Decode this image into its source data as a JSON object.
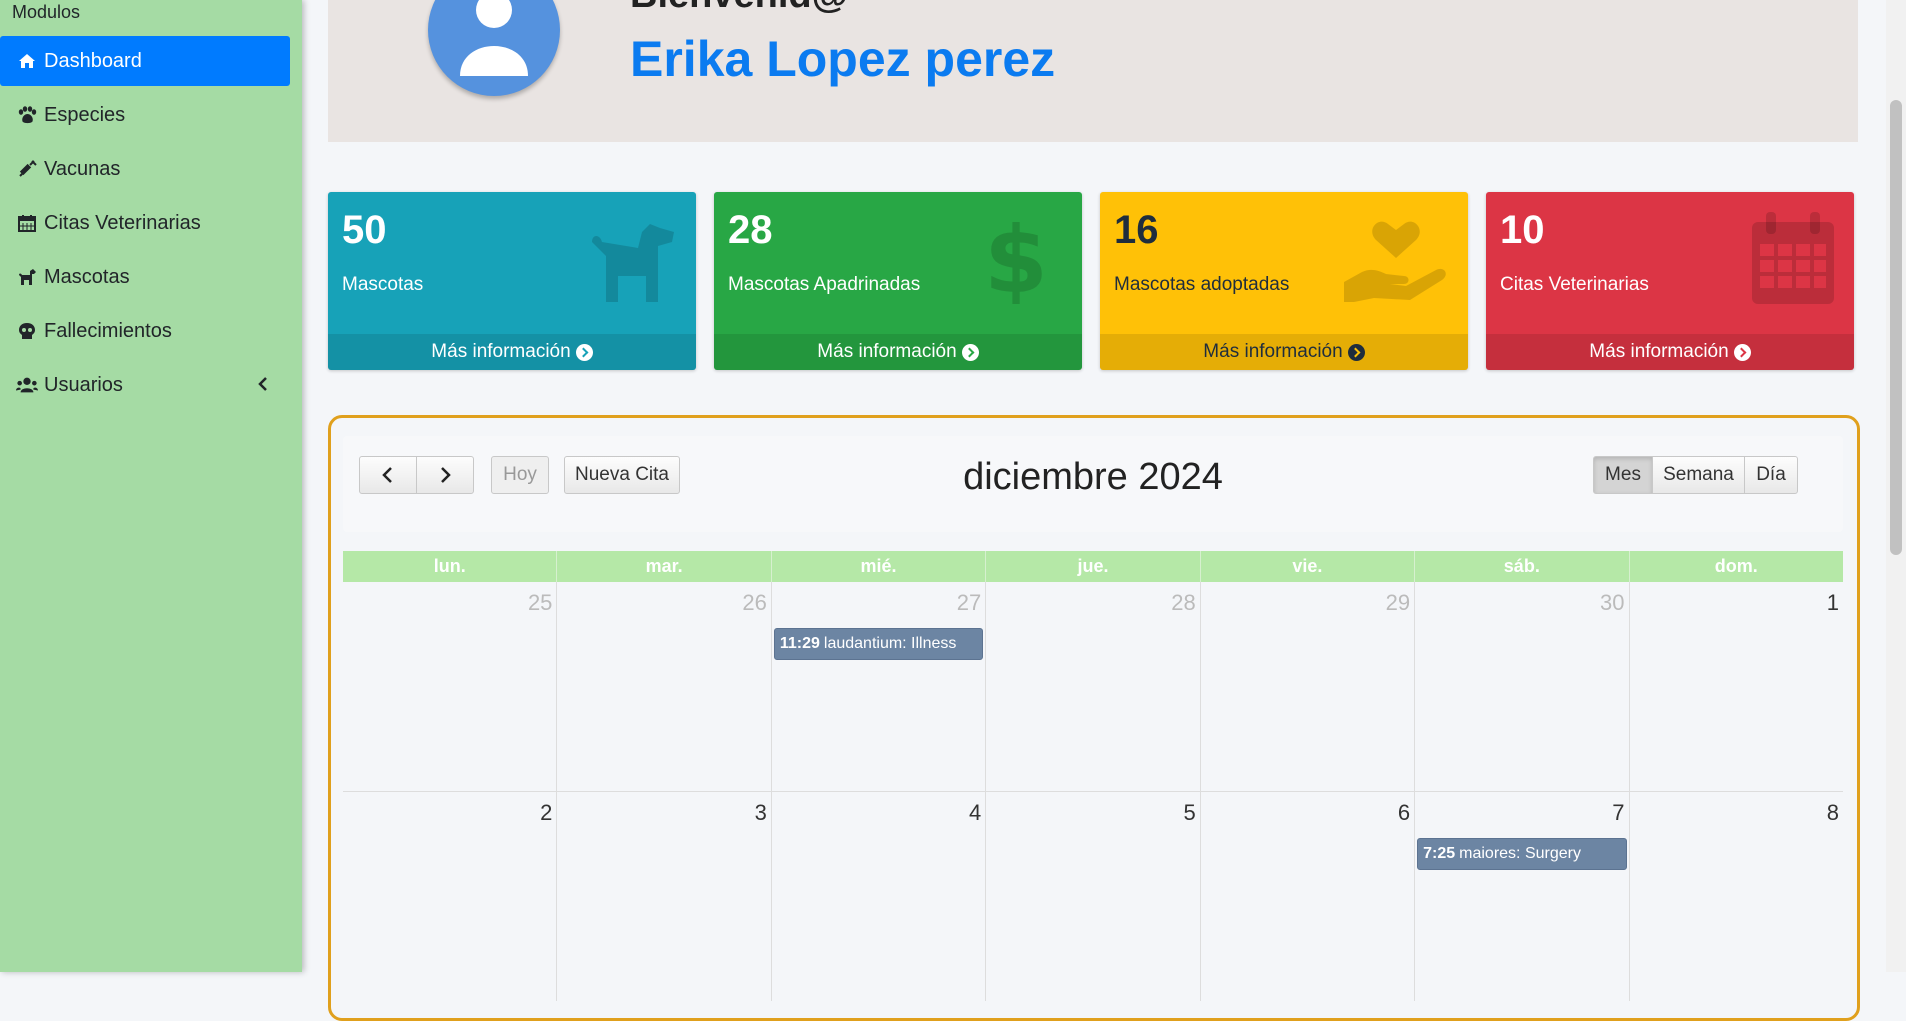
{
  "sidebar": {
    "header": "Modulos",
    "items": [
      {
        "label": "Dashboard",
        "icon": "home-icon"
      },
      {
        "label": "Especies",
        "icon": "paw-icon"
      },
      {
        "label": "Vacunas",
        "icon": "syringe-icon"
      },
      {
        "label": "Citas Veterinarias",
        "icon": "calendar-icon"
      },
      {
        "label": "Mascotas",
        "icon": "dog-icon"
      },
      {
        "label": "Fallecimientos",
        "icon": "skull-icon"
      },
      {
        "label": "Usuarios",
        "icon": "users-icon"
      }
    ]
  },
  "welcome": {
    "greeting": "Bienvenid@",
    "user_name": "Erika Lopez perez"
  },
  "stat_boxes": [
    {
      "value": "50",
      "label": "Mascotas",
      "link": "Más información",
      "color": "#17a2b8",
      "icon": "dog-icon"
    },
    {
      "value": "28",
      "label": "Mascotas Apadrinadas",
      "link": "Más información",
      "color": "#28a745",
      "icon": "dollar-icon"
    },
    {
      "value": "16",
      "label": "Mascotas adoptadas",
      "link": "Más información",
      "color": "#ffc107",
      "icon": "hand-holding-heart-icon"
    },
    {
      "value": "10",
      "label": "Citas Veterinarias",
      "link": "Más información",
      "color": "#dc3545",
      "icon": "calendar-icon"
    }
  ],
  "calendar": {
    "title": "diciembre 2024",
    "buttons": {
      "prev": "‹",
      "next": "›",
      "today": "Hoy",
      "new": "Nueva Cita"
    },
    "views": [
      "Mes",
      "Semana",
      "Día"
    ],
    "active_view": "Mes",
    "weekdays": [
      "lun.",
      "mar.",
      "mié.",
      "jue.",
      "vie.",
      "sáb.",
      "dom."
    ],
    "weeks": [
      [
        "25",
        "26",
        "27",
        "28",
        "29",
        "30",
        "1"
      ],
      [
        "2",
        "3",
        "4",
        "5",
        "6",
        "7",
        "8"
      ]
    ],
    "events": [
      {
        "time": "11:29",
        "title": "laudantium: Illness"
      },
      {
        "time": "7:25",
        "title": "maiores: Surgery"
      }
    ]
  }
}
